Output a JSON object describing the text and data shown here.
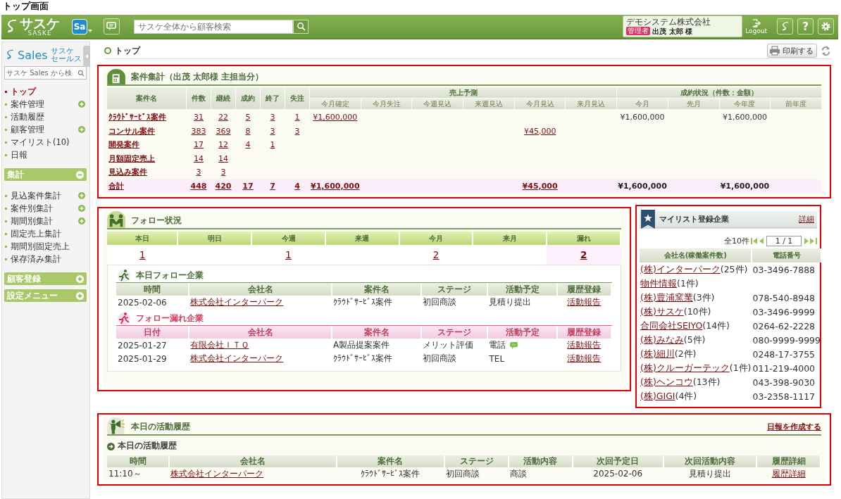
{
  "page_title": "トップ画面",
  "header": {
    "logo": "サスケ",
    "logo_sub": "SASKE",
    "app_badge": "Sa",
    "search_placeholder": "サスケ全体から顧客検索",
    "company": "デモシステム株式会社",
    "role": "管理者",
    "user": "出茂 太郎 様",
    "logout": "Logout",
    "help": "?"
  },
  "sidebar": {
    "logo": "Sales",
    "logo_sub": [
      "サスケ",
      "セールス"
    ],
    "search_placeholder": "サスケ Sales から検",
    "nav": [
      {
        "label": "トップ",
        "selected": true,
        "expandable": false
      },
      {
        "label": "案件管理",
        "selected": false,
        "expandable": true
      },
      {
        "label": "活動履歴",
        "selected": false,
        "expandable": false
      },
      {
        "label": "顧客管理",
        "selected": false,
        "expandable": true
      },
      {
        "label": "マイリスト(10)",
        "selected": false,
        "expandable": false
      },
      {
        "label": "日報",
        "selected": false,
        "expandable": false
      }
    ],
    "groups": [
      {
        "title": "集計",
        "expanded": true,
        "items": [
          {
            "label": "見込案件集計",
            "selected": false,
            "expandable": true
          },
          {
            "label": "案件別集計",
            "selected": false,
            "expandable": true
          },
          {
            "label": "期間別集計",
            "selected": false,
            "expandable": true
          },
          {
            "label": "固定売上集計",
            "selected": false,
            "expandable": false
          },
          {
            "label": "期間別固定売上",
            "selected": false,
            "expandable": false
          },
          {
            "label": "保存済み集計",
            "selected": false,
            "expandable": false
          }
        ]
      },
      {
        "title": "顧客登録",
        "expanded": false
      },
      {
        "title": "設定メニュー",
        "expanded": false
      }
    ]
  },
  "breadcrumb": "トップ",
  "print": "印刷する",
  "summary": {
    "title": "案件集計（出茂 太郎様 主担当分）",
    "columns": [
      "案件名",
      "件数",
      "継続",
      "成約",
      "終了",
      "失注"
    ],
    "groups": [
      {
        "label": "売上予測",
        "columns": [
          "今月確定",
          "今月失注",
          "今週見込",
          "来週見込",
          "今月見込",
          "来月見込"
        ]
      },
      {
        "label": "成約状況（件数：金額）",
        "columns": [
          "今月",
          "先月",
          "今年度",
          "前年度"
        ]
      }
    ],
    "rows": [
      {
        "name": "ｸﾗｳﾄﾞｻｰﾋﾞｽ案件",
        "kind": "item",
        "counts": [
          "31",
          "22",
          "5",
          "3",
          "1"
        ],
        "forecast": {
          "this_month_confirmed": "¥1,600,000"
        },
        "status": {
          "this_month": "¥1,600,000",
          "this_year": "¥1,600,000"
        }
      },
      {
        "name": "コンサル案件",
        "kind": "item",
        "counts": [
          "383",
          "369",
          "8",
          "3",
          "3"
        ],
        "forecast": {
          "this_month_expected": "¥45,000"
        }
      },
      {
        "name": "開発案件",
        "kind": "item",
        "counts": [
          "17",
          "12",
          "4",
          "1"
        ]
      },
      {
        "name": "月額固定売上",
        "kind": "item",
        "counts": [
          "14",
          "14"
        ]
      },
      {
        "name": "見込み案件",
        "kind": "item",
        "counts": [
          "3",
          "3"
        ]
      },
      {
        "name": "合計",
        "kind": "total",
        "counts": [
          "448",
          "420",
          "17",
          "7",
          "4"
        ],
        "forecast": {
          "this_month_confirmed": "¥1,600,000",
          "this_month_expected": "¥45,000"
        },
        "status": {
          "this_month": "¥1,600,000",
          "this_year": "¥1,600,000"
        }
      }
    ]
  },
  "follow": {
    "title": "フォロー状況",
    "periods": [
      {
        "label": "本日",
        "count": "1",
        "kind": "normal"
      },
      {
        "label": "明日",
        "kind": "normal"
      },
      {
        "label": "今週",
        "count": "1",
        "kind": "normal"
      },
      {
        "label": "来週",
        "kind": "normal"
      },
      {
        "label": "今月",
        "count": "2",
        "kind": "normal"
      },
      {
        "label": "来月",
        "kind": "normal"
      },
      {
        "label": "漏れ",
        "count": "2",
        "kind": "overdue"
      }
    ],
    "today": {
      "title": "本日フォロー企業",
      "columns": [
        "時間",
        "会社名",
        "案件名",
        "ステージ",
        "活動予定",
        "履歴登録"
      ],
      "rows": [
        {
          "date": "2025-02-06",
          "company": "株式会社インターパーク",
          "project": "ｸﾗｳﾄﾞｻｰﾋﾞｽ案件",
          "stage": "初回商談",
          "plan": "見積り提出",
          "memo": false,
          "action": "活動報告"
        }
      ]
    },
    "missed": {
      "title": "フォロー漏れ企業",
      "columns": [
        "日付",
        "会社名",
        "案件名",
        "ステージ",
        "活動予定",
        "履歴登録"
      ],
      "rows": [
        {
          "date": "2025-01-27",
          "company": "有限会社ＩＴＱ",
          "project": "A製品提案案件",
          "stage": "メリット評価",
          "plan": "電話",
          "memo": true,
          "action": "活動報告"
        },
        {
          "date": "2025-01-29",
          "company": "株式会社インターパーク",
          "project": "ｸﾗｳﾄﾞｻｰﾋﾞｽ案件",
          "stage": "初回商談",
          "plan": "TEL",
          "memo": false,
          "action": "活動報告"
        }
      ]
    }
  },
  "mylist": {
    "title": "マイリスト登録企業",
    "detail": "詳細",
    "total": "全10件",
    "page": "1 / 1",
    "columns": [
      "会社名(稼働案件数)",
      "電話番号"
    ],
    "rows": [
      {
        "company": "(株)インターパーク",
        "count": "(25件)",
        "phone": "03-3496-7888"
      },
      {
        "company": "物件情報",
        "count": "(1件)"
      },
      {
        "company": "(株)豊浦窯業",
        "count": "(3件)",
        "phone": "078-540-8948"
      },
      {
        "company": "(株)サスケ",
        "count": "(10件)",
        "phone": "03-3496-9999"
      },
      {
        "company": "合同会社SEIYO",
        "count": "(14件)",
        "phone": "0264-62-2228"
      },
      {
        "company": "(株)みなみ",
        "count": "(5件)",
        "phone": "080-9999-9999"
      },
      {
        "company": "(株)細川",
        "count": "(2件)",
        "phone": "0248-17-3755"
      },
      {
        "company": "(株)クルーガーテック",
        "count": "(1件)",
        "phone": "011-219-4000"
      },
      {
        "company": "(株)ヘンコウ",
        "count": "(13件)",
        "phone": "043-398-9030"
      },
      {
        "company": "(株)GIGI",
        "count": "(4件)",
        "phone": "03-2358-1117"
      }
    ]
  },
  "activity": {
    "title": "本日の活動履歴",
    "create_link": "日報を作成する",
    "subtitle": "本日の活動履歴",
    "columns": [
      "時間",
      "会社名",
      "案件名",
      "ステージ",
      "活動内容",
      "次回予定日",
      "次回活動内容",
      "履歴詳細"
    ],
    "rows": [
      {
        "time": "11:10～",
        "company": "株式会社インターパーク",
        "project": "ｸﾗｳﾄﾞｻｰﾋﾞｽ案件",
        "stage": "初回商談",
        "content": "商談",
        "next_date": "2025-02-06",
        "next_content": "見積り提出",
        "detail": "履歴詳細"
      }
    ]
  }
}
